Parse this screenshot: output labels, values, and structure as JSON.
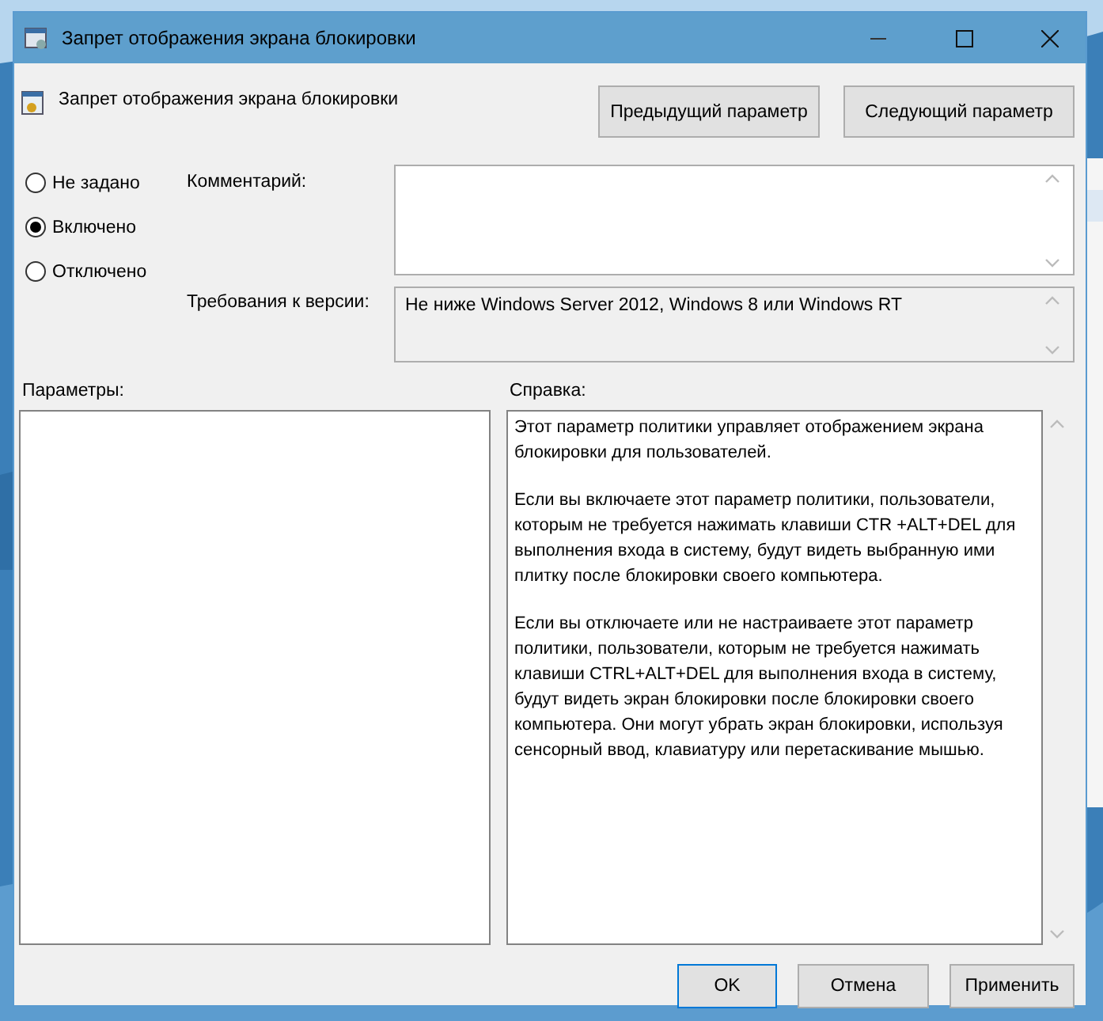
{
  "window": {
    "title": "Запрет отображения экрана блокировки"
  },
  "header": {
    "title": "Запрет отображения экрана блокировки",
    "buttons": [
      "Предыдущий параметр",
      "Следующий параметр"
    ]
  },
  "states": [
    {
      "label": "Не задано",
      "selected": false
    },
    {
      "label": "Включено",
      "selected": true
    },
    {
      "label": "Отключено",
      "selected": false
    }
  ],
  "comment": {
    "label": "Комментарий:"
  },
  "version": {
    "label": "Требования к версии:",
    "value": "Не ниже Windows Server 2012, Windows 8 или Windows RT"
  },
  "options": {
    "label": "Параметры:"
  },
  "help": {
    "label": "Справка:",
    "paragraphs": [
      "Этот параметр политики управляет отображением экрана\nблокировки для пользователей.",
      "Если вы включаете этот параметр политики, пользователи,\nкоторым не требуется нажимать клавиши CTR +ALT+DEL для\nвыполнения входа в систему, будут видеть выбранную ими\nплитку после блокировки своего компьютера.",
      "Если вы отключаете или не настраиваете этот параметр\nполитики, пользователи, которым не требуется нажимать\nклавиши CTRL+ALT+DEL для выполнения входа в систему,\nбудут видеть экран блокировки после блокировки своего\nкомпьютера. Они могут убрать экран блокировки, используя\nсенсорный ввод, клавиатуру или перетаскивание мышью."
    ]
  },
  "footer": [
    {
      "label": "OK",
      "default": true
    },
    {
      "label": "Отмена",
      "default": false
    },
    {
      "label": "Применить",
      "default": false
    }
  ]
}
